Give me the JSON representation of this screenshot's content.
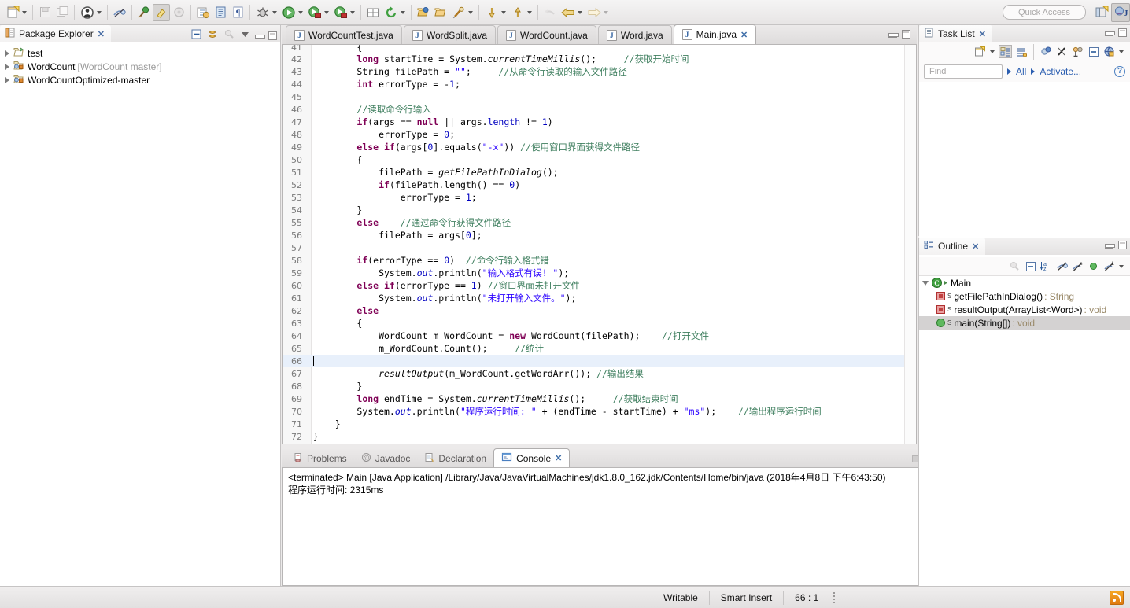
{
  "toolbar": {
    "quick_access_placeholder": "Quick Access",
    "icons": [
      "new-wizard-icon",
      "save-icon",
      "save-all-icon",
      "user-profile-icon",
      "hide-fields-icon",
      "annotations-icon",
      "highlight-icon",
      "refresh-icon",
      "open-task-icon",
      "print-preview-icon",
      "paragraph-marks-icon",
      "debug-icon",
      "run-icon",
      "coverage-icon",
      "profile-icon",
      "new-package-icon",
      "refresh-project-icon",
      "open-type-icon",
      "open-folder-icon",
      "search-icon",
      "next-annotation-icon",
      "previous-annotation-icon",
      "undo-history-icon",
      "back-icon",
      "forward-icon"
    ],
    "perspective_icons": [
      "open-perspective-icon",
      "java-perspective-icon"
    ]
  },
  "package_explorer": {
    "title": "Package Explorer",
    "toolbar_icons": [
      "collapse-all-icon",
      "link-with-editor-icon",
      "focus-icon",
      "view-menu-icon",
      "minimize-icon",
      "maximize-icon"
    ],
    "tree": [
      {
        "label": "test",
        "branch": "",
        "icon": "folder-icon",
        "expanded": false
      },
      {
        "label": "WordCount",
        "branch": "[WordCount master]",
        "icon": "java-project-icon",
        "expanded": false
      },
      {
        "label": "WordCountOptimized-master",
        "branch": "",
        "icon": "java-project-icon",
        "expanded": false
      }
    ]
  },
  "editor": {
    "tabs": [
      {
        "label": "WordCountTest.java",
        "active": false
      },
      {
        "label": "WordSplit.java",
        "active": false
      },
      {
        "label": "WordCount.java",
        "active": false
      },
      {
        "label": "Word.java",
        "active": false
      },
      {
        "label": "Main.java",
        "active": true
      }
    ],
    "minimize_label": "minimize-icon",
    "maximize_label": "maximize-icon",
    "first_visible_line": 41,
    "cursor_line": 66,
    "lines": [
      {
        "n": 41,
        "clipped": true,
        "html": "        {"
      },
      {
        "n": 42,
        "html": "        <span class=\"kw\">long</span> startTime = System.<span class=\"ital\">currentTimeMillis</span>();     <span class=\"cmt\">//获取开始时间</span>"
      },
      {
        "n": 43,
        "html": "        String filePath = <span class=\"str\">\"\"</span>;     <span class=\"cmt\">//从命令行读取的输入文件路径</span>"
      },
      {
        "n": 44,
        "html": "        <span class=\"kw\">int</span> errorType = -<span class=\"fld\">1</span>;"
      },
      {
        "n": 45,
        "html": ""
      },
      {
        "n": 46,
        "html": "        <span class=\"cmt\">//读取命令行输入</span>"
      },
      {
        "n": 47,
        "html": "        <span class=\"kw\">if</span>(args == <span class=\"kw\">null</span> || args.<span class=\"fld\">length</span> != <span class=\"fld\">1</span>)"
      },
      {
        "n": 48,
        "html": "            errorType = <span class=\"fld\">0</span>;"
      },
      {
        "n": 49,
        "html": "        <span class=\"kw\">else if</span>(args[<span class=\"fld\">0</span>].equals(<span class=\"str\">\"-x\"</span>)) <span class=\"cmt\">//使用窗口界面获得文件路径</span>"
      },
      {
        "n": 50,
        "html": "        {"
      },
      {
        "n": 51,
        "html": "            filePath = <span class=\"ital\">getFilePathInDialog</span>();"
      },
      {
        "n": 52,
        "html": "            <span class=\"kw\">if</span>(filePath.length() == <span class=\"fld\">0</span>)"
      },
      {
        "n": 53,
        "html": "                errorType = <span class=\"fld\">1</span>;"
      },
      {
        "n": 54,
        "html": "        }"
      },
      {
        "n": 55,
        "html": "        <span class=\"kw\">else</span>    <span class=\"cmt\">//通过命令行获得文件路径</span>"
      },
      {
        "n": 56,
        "html": "            filePath = args[<span class=\"fld\">0</span>];"
      },
      {
        "n": 57,
        "html": ""
      },
      {
        "n": 58,
        "html": "        <span class=\"kw\">if</span>(errorType == <span class=\"fld\">0</span>)  <span class=\"cmt\">//命令行输入格式错</span>"
      },
      {
        "n": 59,
        "html": "            System.<span class=\"ital fld\">out</span>.println(<span class=\"str\">\"输入格式有误! \"</span>);"
      },
      {
        "n": 60,
        "html": "        <span class=\"kw\">else if</span>(errorType == <span class=\"fld\">1</span>) <span class=\"cmt\">//窗口界面未打开文件</span>"
      },
      {
        "n": 61,
        "html": "            System.<span class=\"ital fld\">out</span>.println(<span class=\"str\">\"未打开输入文件。\"</span>);"
      },
      {
        "n": 62,
        "html": "        <span class=\"kw\">else</span>"
      },
      {
        "n": 63,
        "html": "        {"
      },
      {
        "n": 64,
        "html": "            WordCount m_WordCount = <span class=\"kw\">new</span> WordCount(filePath);    <span class=\"cmt\">//打开文件</span>"
      },
      {
        "n": 65,
        "html": "            m_WordCount.Count();     <span class=\"cmt\">//统计</span>"
      },
      {
        "n": 66,
        "html": "",
        "current": true
      },
      {
        "n": 67,
        "html": "            <span class=\"ital\">resultOutput</span>(m_WordCount.getWordArr()); <span class=\"cmt\">//输出结果</span>"
      },
      {
        "n": 68,
        "html": "        }"
      },
      {
        "n": 69,
        "html": "        <span class=\"kw\">long</span> endTime = System.<span class=\"ital\">currentTimeMillis</span>();     <span class=\"cmt\">//获取结束时间</span>"
      },
      {
        "n": 70,
        "html": "        System.<span class=\"ital fld\">out</span>.println(<span class=\"str\">\"程序运行时间: \"</span> + (endTime - startTime) + <span class=\"str\">\"ms\"</span>);    <span class=\"cmt\">//输出程序运行时间</span>"
      },
      {
        "n": 71,
        "html": "    }"
      },
      {
        "n": 72,
        "html": "}"
      }
    ]
  },
  "console": {
    "tabs": [
      {
        "label": "Problems",
        "icon": "problems-icon",
        "active": false
      },
      {
        "label": "Javadoc",
        "icon": "javadoc-icon",
        "active": false
      },
      {
        "label": "Declaration",
        "icon": "declaration-icon",
        "active": false
      },
      {
        "label": "Console",
        "icon": "console-icon",
        "active": true
      }
    ],
    "toolbar_icons": [
      "terminate-disabled-icon",
      "remove-launch-icon",
      "remove-all-launches-icon",
      "clear-console-icon",
      "scroll-lock-icon",
      "show-console-on-output-icon",
      "pin-console-icon",
      "display-selected-console-icon",
      "open-console-icon",
      "new-console-view-icon",
      "minimize-icon",
      "maximize-icon"
    ],
    "output_lines": [
      "<terminated> Main [Java Application] /Library/Java/JavaVirtualMachines/jdk1.8.0_162.jdk/Contents/Home/bin/java (2018年4月8日 下午6:43:50)",
      "程序运行时间: 2315ms"
    ]
  },
  "task_list": {
    "title": "Task List",
    "toolbar_icons": [
      "new-task-icon",
      "categorized-presentation-icon",
      "scheduled-presentation-icon",
      "synchronize-icon",
      "focus-on-workweek-icon",
      "collapse-all-icon",
      "restore-icon",
      "task-repositories-icon",
      "view-menu-icon"
    ],
    "find_placeholder": "Find",
    "filter_all_label": "All",
    "activate_label": "Activate...",
    "help_label": "?"
  },
  "outline": {
    "title": "Outline",
    "toolbar_icons": [
      "focus-icon",
      "collapse-all-icon",
      "sort-icon",
      "hide-non-public-icon",
      "hide-static-icon",
      "hide-fields-icon",
      "hide-local-types-icon",
      "view-menu-icon"
    ],
    "items": [
      {
        "label": "Main",
        "kind": "class",
        "indent": 0,
        "expanded": true,
        "selected": false
      },
      {
        "label": "getFilePathInDialog()",
        "return_type": " : String",
        "kind": "private-static-method",
        "indent": 1,
        "selected": false
      },
      {
        "label": "resultOutput(ArrayList<Word>)",
        "return_type": " : void",
        "kind": "private-static-method",
        "indent": 1,
        "selected": false
      },
      {
        "label": "main(String[])",
        "return_type": " : void",
        "kind": "public-static-method",
        "indent": 1,
        "selected": true
      }
    ]
  },
  "status_bar": {
    "writable": "Writable",
    "insert_mode": "Smart Insert",
    "position": "66 : 1",
    "rss_icon": "rss-feed-icon"
  }
}
